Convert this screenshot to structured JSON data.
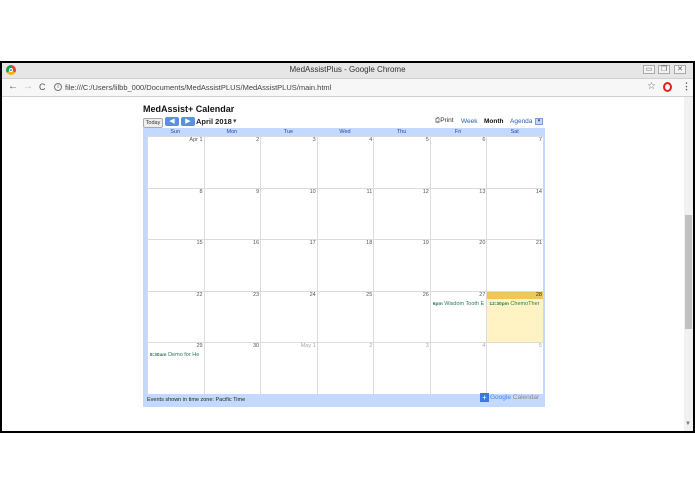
{
  "browser": {
    "window_title": "MedAssistPlus - Google Chrome",
    "address": "file:///C:/Users/lilbb_000/Documents/MedAssistPLUS/MedAssistPLUS/main.html",
    "buttons": {
      "minimize": "▭",
      "restore": "❐",
      "close": "✕"
    },
    "nav": {
      "back": "←",
      "forward": "→",
      "reload": "C",
      "info": "i",
      "star": "☆",
      "menu": "⋮"
    }
  },
  "calendar": {
    "title": "MedAssist+ Calendar",
    "today_label": "Today",
    "prev_label": "◀",
    "next_label": "▶",
    "month_label": "April 2018",
    "month_caret": "▾",
    "print_label": "Print",
    "print_icon": "⎙",
    "views": {
      "week": "Week",
      "month": "Month",
      "agenda": "Agenda"
    },
    "agenda_caret": "▾",
    "weekdays": [
      "Sun",
      "Mon",
      "Tue",
      "Wed",
      "Thu",
      "Fri",
      "Sat"
    ],
    "weeks": [
      [
        {
          "day": "Apr 1"
        },
        {
          "day": "2"
        },
        {
          "day": "3"
        },
        {
          "day": "4"
        },
        {
          "day": "5"
        },
        {
          "day": "6"
        },
        {
          "day": "7"
        }
      ],
      [
        {
          "day": "8"
        },
        {
          "day": "9"
        },
        {
          "day": "10"
        },
        {
          "day": "11"
        },
        {
          "day": "12"
        },
        {
          "day": "13"
        },
        {
          "day": "14"
        }
      ],
      [
        {
          "day": "15"
        },
        {
          "day": "16"
        },
        {
          "day": "17"
        },
        {
          "day": "18"
        },
        {
          "day": "19"
        },
        {
          "day": "20"
        },
        {
          "day": "21"
        }
      ],
      [
        {
          "day": "22"
        },
        {
          "day": "23"
        },
        {
          "day": "24"
        },
        {
          "day": "25"
        },
        {
          "day": "26"
        },
        {
          "day": "27",
          "event": {
            "time": "6pm",
            "title": "Wisdom Tooth E"
          }
        },
        {
          "day": "28",
          "today": true,
          "event": {
            "time": "12:30pm",
            "title": "ChemoTher"
          }
        }
      ],
      [
        {
          "day": "29",
          "event": {
            "time": "8:30am",
            "title": "Demo for He"
          }
        },
        {
          "day": "30"
        },
        {
          "day": "May 1",
          "other": true
        },
        {
          "day": "2",
          "other": true
        },
        {
          "day": "3",
          "other": true
        },
        {
          "day": "4",
          "other": true
        },
        {
          "day": "5",
          "other": true
        }
      ]
    ],
    "timezone_text": "Events shown in time zone: Pacific Time",
    "google_brand": "Google",
    "google_product": "Calendar",
    "colors": {
      "frame": "#c3d9ff",
      "today_bg": "#fff3c4",
      "today_header": "#f0c659",
      "event_text": "#2a7a55",
      "nav_button": "#5b8ee4"
    }
  }
}
